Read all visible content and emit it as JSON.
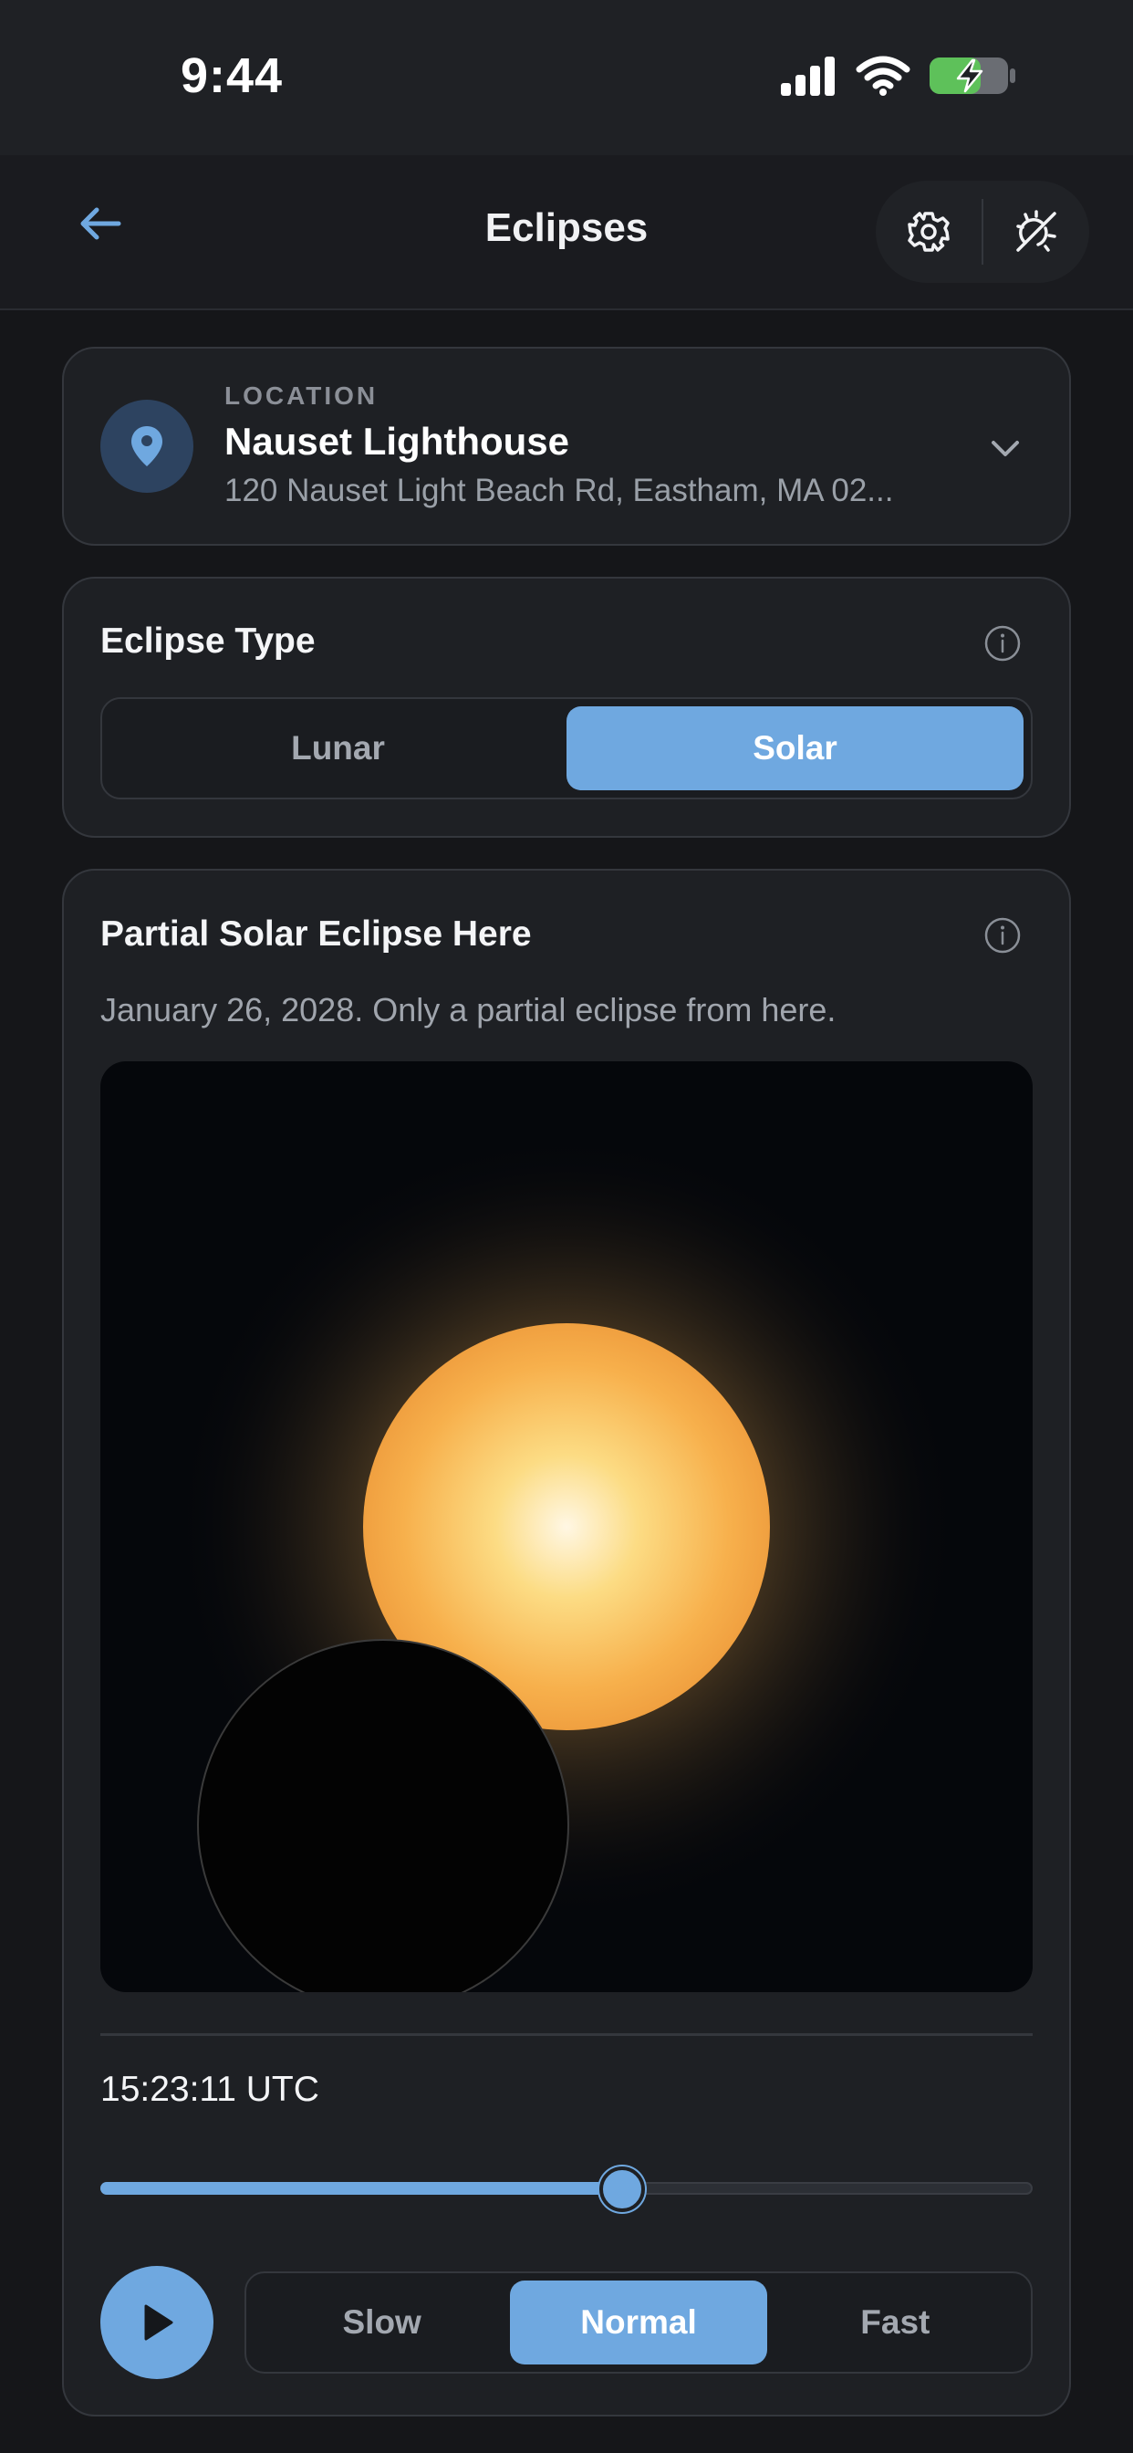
{
  "status_bar": {
    "time": "9:44"
  },
  "nav": {
    "title": "Eclipses",
    "back_icon": "back-arrow-icon",
    "settings_icon": "gear-icon",
    "toggle_icon": "sun-off-icon"
  },
  "location": {
    "label": "LOCATION",
    "name": "Nauset Lighthouse",
    "address": "120 Nauset Light Beach Rd, Eastham, MA 02..."
  },
  "eclipse_type": {
    "title": "Eclipse Type",
    "options": [
      "Lunar",
      "Solar"
    ],
    "selected": "Solar"
  },
  "eclipse": {
    "title": "Partial Solar Eclipse Here",
    "subtitle": "January 26, 2028. Only a partial eclipse from here.",
    "time": "15:23:11 UTC",
    "progress": 0.56
  },
  "speed": {
    "options": [
      "Slow",
      "Normal",
      "Fast"
    ],
    "selected": "Normal"
  },
  "colors": {
    "accent": "#6fa8e0",
    "background": "#151619",
    "card": "#1e2024"
  }
}
